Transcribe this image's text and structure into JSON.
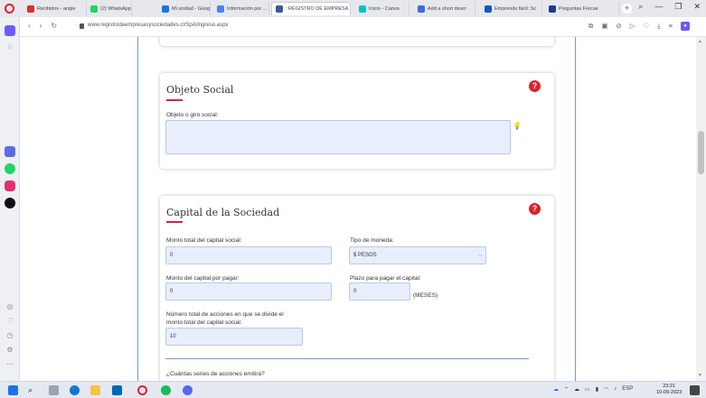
{
  "browser": {
    "tabs": [
      {
        "label": "Recibidos - angie",
        "color": "#d93025"
      },
      {
        "label": "(2) WhatsApp",
        "color": "#25d366"
      },
      {
        "label": "Mi unidad - Goog",
        "color": "#1a73e8"
      },
      {
        "label": "Información por ...",
        "color": "#4285f4"
      },
      {
        "label": "::REGISTRO DE EMPRESA",
        "color": "#3b5998"
      },
      {
        "label": "Inicio - Canva",
        "color": "#00c4cc"
      },
      {
        "label": "Add a short descr",
        "color": "#3d6fd8"
      },
      {
        "label": "Emprende fácil: Sc",
        "color": "#0b57d0"
      },
      {
        "label": "Preguntas Frecue",
        "color": "#1b3e8a"
      }
    ],
    "url": "www.registrodeempresasysociedades.cl/SpA/ingreso.aspx",
    "window_controls": [
      "search-icon",
      "minimize-icon",
      "restore-icon",
      "close-icon"
    ]
  },
  "objeto_social": {
    "title": "Objeto Social",
    "field_label": "Objeto o giro social:",
    "value": ""
  },
  "capital": {
    "title": "Capital de la Sociedad",
    "monto_total_label": "Monto total del capital social:",
    "monto_total_value": "0",
    "tipo_moneda_label": "Tipo de moneda:",
    "tipo_moneda_value": "$ PESOS",
    "monto_por_pagar_label": "Monto del capital por pagar:",
    "monto_por_pagar_value": "0",
    "plazo_label": "Plazo para pagar el capital:",
    "plazo_value": "0",
    "plazo_unit": "(MESES)",
    "acciones_label_line1": "Número total de acciones en que se divide el",
    "acciones_label_line2": "monto total del capital social:",
    "acciones_value": "10",
    "series_label": "¿Cuántas series de acciones emitirá?"
  },
  "help_symbol": "?",
  "taskbar": {
    "lang": "ESP",
    "time": "23:21",
    "date": "10-09-2023"
  }
}
